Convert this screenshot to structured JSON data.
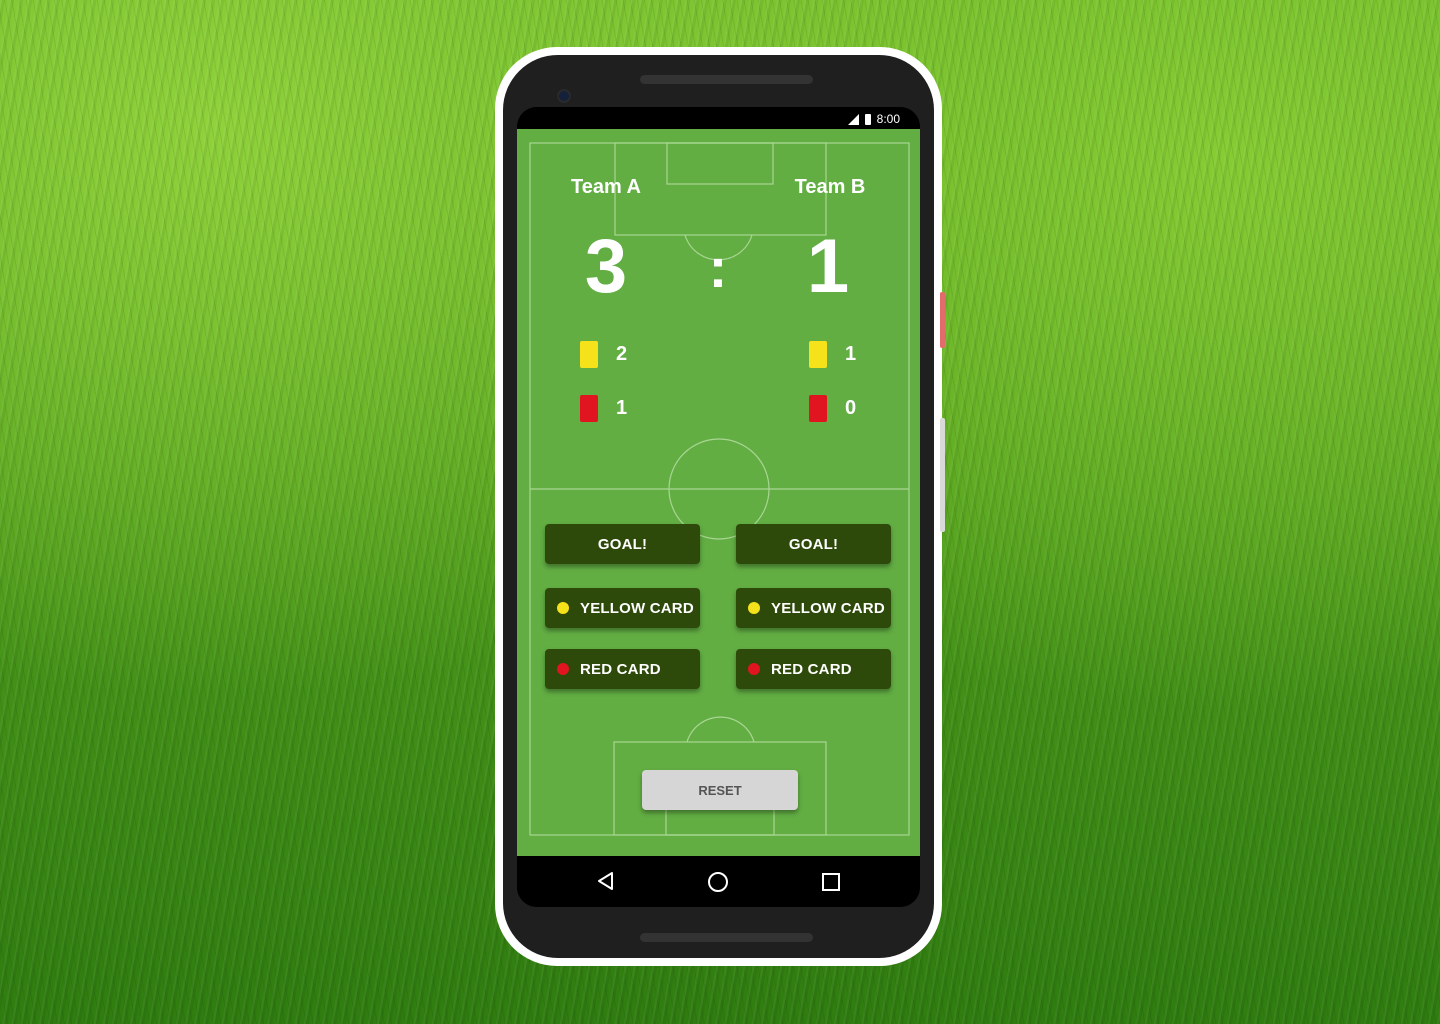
{
  "status_bar": {
    "time": "8:00",
    "icons": [
      "signal-icon",
      "battery-icon"
    ]
  },
  "team_a": {
    "name": "Team A",
    "score": "3",
    "yellow_cards": "2",
    "red_cards": "1",
    "goal_label": "GOAL!",
    "yellow_label": "YELLOW CARD",
    "red_label": "RED CARD"
  },
  "team_b": {
    "name": "Team B",
    "score": "1",
    "yellow_cards": "1",
    "red_cards": "0",
    "goal_label": "GOAL!",
    "yellow_label": "YELLOW CARD",
    "red_label": "RED CARD"
  },
  "score_separator": ":",
  "reset_label": "RESET",
  "nav_bar": {
    "icons": [
      "back-icon",
      "home-icon",
      "recents-icon"
    ]
  },
  "colors": {
    "field": "#62ae43",
    "button": "#2e4a0a",
    "yellow_card": "#f6e21b",
    "red_card": "#e0151f",
    "reset_button": "#d6d6d6"
  }
}
